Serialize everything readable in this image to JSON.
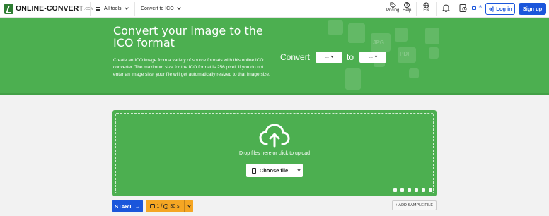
{
  "nav": {
    "logo_text": "ONLINE-CONVERT",
    "logo_suffix": ".COM",
    "all_tools": "All tools",
    "current_tool": "Convert to ICO",
    "pricing": "Pricing",
    "help": "Help",
    "language": "EN",
    "count_badge": "16",
    "login": "Log in",
    "signup": "Sign up"
  },
  "hero": {
    "title": "Convert your image to the ICO format",
    "description": "Create an ICO image from a variety of source formats with this online ICO converter. The maximum size for the ICO format is 256 pixel. If you do not enter an image size, your file will get automatically resized to that image size.",
    "convert_label": "Convert",
    "to_label": "to",
    "from_select": "...",
    "to_select": "...",
    "deco_jpg": "JPG",
    "deco_pdf": "PDF"
  },
  "dropzone": {
    "drop_text": "Drop files here or click to upload",
    "choose_file": "Choose file"
  },
  "bottom": {
    "start": "START",
    "files_count": "1",
    "separator": "/",
    "time_limit": "30 s",
    "add_sample": "+ ADD SAMPLE FILE"
  }
}
